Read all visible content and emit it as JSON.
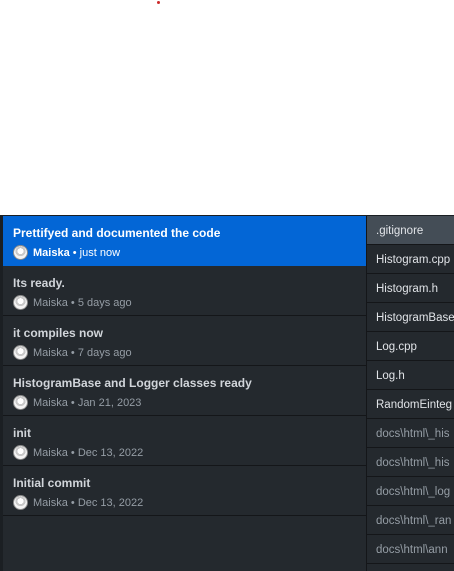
{
  "commits": [
    {
      "title": "Prettifyed and documented the code",
      "author": "Maiska",
      "time": "just now"
    },
    {
      "title": "Its ready.",
      "author": "Maiska",
      "time": "5 days ago"
    },
    {
      "title": "it compiles now",
      "author": "Maiska",
      "time": "7 days ago"
    },
    {
      "title": "HistogramBase and Logger classes ready",
      "author": "Maiska",
      "time": "Jan 21, 2023"
    },
    {
      "title": "init",
      "author": "Maiska",
      "time": "Dec 13, 2022"
    },
    {
      "title": "Initial commit",
      "author": "Maiska",
      "time": "Dec 13, 2022"
    }
  ],
  "separator": " • ",
  "files": [
    ".gitignore",
    "Histogram.cpp",
    "Histogram.h",
    "HistogramBase",
    "Log.cpp",
    "Log.h",
    "RandomEinteg",
    "docs\\html\\_his",
    "docs\\html\\_his",
    "docs\\html\\_log",
    "docs\\html\\_ran",
    "docs\\html\\ann"
  ],
  "colors": {
    "accent": "#0366d6",
    "background": "#24292e"
  }
}
